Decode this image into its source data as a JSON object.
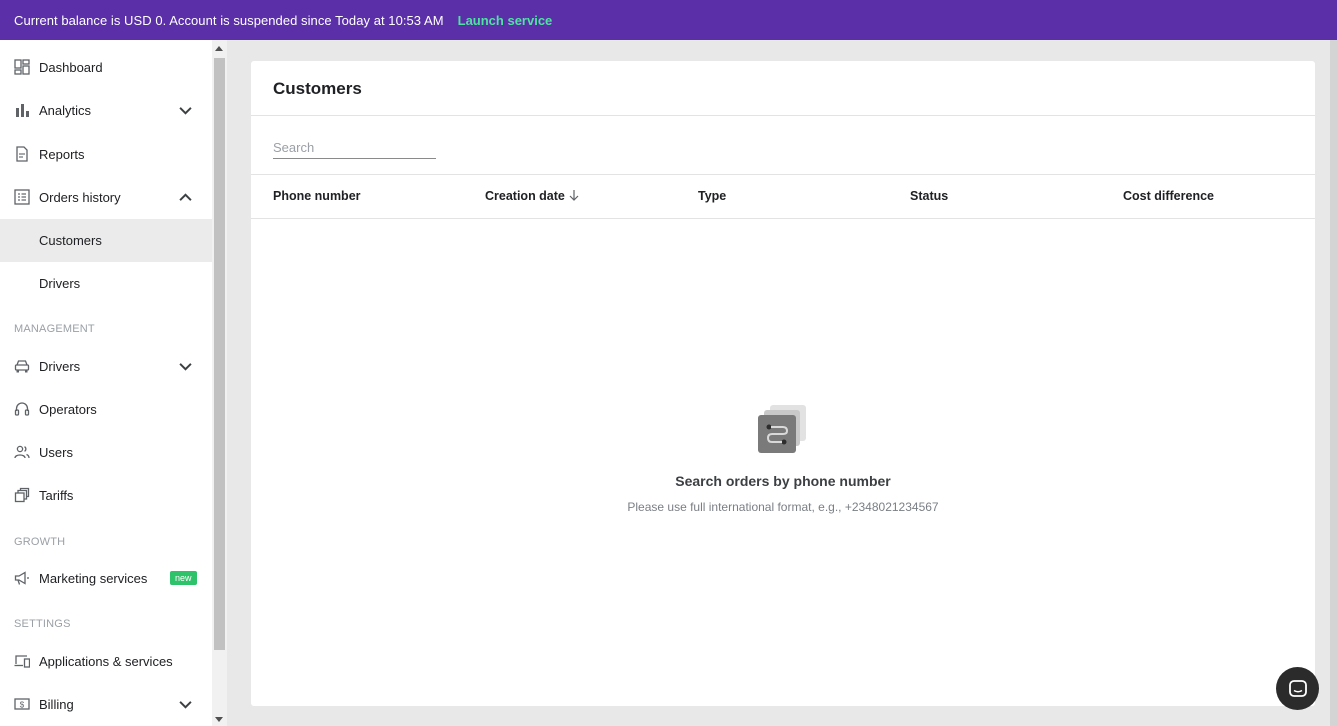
{
  "banner": {
    "message": "Current balance is USD 0. Account is suspended since Today at 10:53 AM",
    "launch_label": "Launch service"
  },
  "sidebar": {
    "items": [
      {
        "key": "dashboard",
        "label": "Dashboard",
        "icon": "dashboard-icon"
      },
      {
        "key": "analytics",
        "label": "Analytics",
        "icon": "bar-chart-icon",
        "expandable": true,
        "expanded": false
      },
      {
        "key": "reports",
        "label": "Reports",
        "icon": "document-icon"
      },
      {
        "key": "orders-history",
        "label": "Orders history",
        "icon": "list-icon",
        "expandable": true,
        "expanded": true
      },
      {
        "key": "customers",
        "label": "Customers",
        "active": true,
        "sub": true
      },
      {
        "key": "drivers-history",
        "label": "Drivers",
        "sub": true
      }
    ],
    "management_label": "MANAGEMENT",
    "management": [
      {
        "key": "drivers",
        "label": "Drivers",
        "icon": "car-icon",
        "expandable": true,
        "expanded": false
      },
      {
        "key": "operators",
        "label": "Operators",
        "icon": "headset-icon"
      },
      {
        "key": "users",
        "label": "Users",
        "icon": "people-icon"
      },
      {
        "key": "tariffs",
        "label": "Tariffs",
        "icon": "tariffs-icon"
      }
    ],
    "growth_label": "GROWTH",
    "growth": [
      {
        "key": "marketing",
        "label": "Marketing services",
        "icon": "megaphone-icon",
        "badge": "new"
      }
    ],
    "settings_label": "SETTINGS",
    "settings": [
      {
        "key": "apps",
        "label": "Applications & services",
        "icon": "devices-icon"
      },
      {
        "key": "billing",
        "label": "Billing",
        "icon": "billing-icon",
        "expandable": true,
        "expanded": false
      }
    ]
  },
  "main": {
    "title": "Customers",
    "search_placeholder": "Search",
    "columns": [
      "Phone number",
      "Creation date",
      "Type",
      "Status",
      "Cost difference"
    ],
    "sort_column": "Creation date",
    "sort_direction": "descending",
    "empty": {
      "title": "Search orders by phone number",
      "subtitle": "Please use full international format, e.g., +2348021234567"
    }
  },
  "colors": {
    "banner_bg": "#5a2fa8",
    "launch_link": "#4ee3a0",
    "badge_bg": "#2ec26a",
    "active_item_bg": "#ebebeb",
    "page_bg": "#e8e8e8"
  }
}
